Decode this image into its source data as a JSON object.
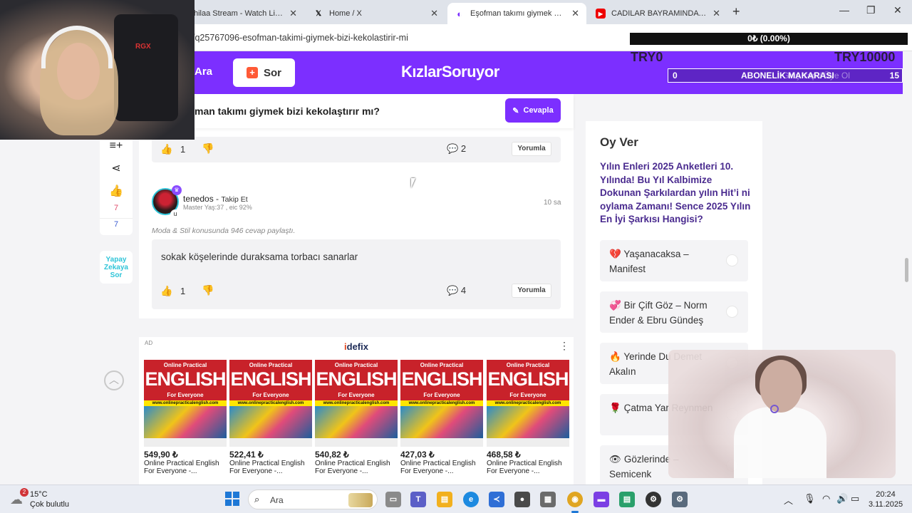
{
  "browser": {
    "tabs": [
      {
        "title": "hilaa Stream - Watch Live on",
        "icon": "twitch-icon"
      },
      {
        "title": "Home / X",
        "icon": "x-logo-icon"
      },
      {
        "title": "Eşofman takımı giymek bizi kek",
        "icon": "kizlarsoruyor-icon",
        "active": true
      },
      {
        "title": "CADILAR BAYRAMINDA EVLEN",
        "icon": "youtube-icon"
      }
    ],
    "url": "/q25767096-esofman-takimi-giymek-bizi-kekolastirir-mi"
  },
  "overlay": {
    "progress_text": "0₺ (0.00%)",
    "progress_fraction": 0.0,
    "try_left": "TRY0",
    "try_right": "TRY10000",
    "sub_left": "0",
    "sub_label": "ABONELİK MAKARASI",
    "sub_right": "15",
    "ghost_text": "Giriş Yap / Üye Ol"
  },
  "header": {
    "search_label": "Ara",
    "ask_button": "Sor",
    "logo": "KızlarSoruyor"
  },
  "question": {
    "title": "man takımı giymek bizi kekolaştırır mı?",
    "answer_button": "Cevapla"
  },
  "sidebar": {
    "likes_count": "7",
    "dislikes_count": "7",
    "ai_button": "Yapay Zekaya Sor"
  },
  "answers": [
    {
      "likes": "1",
      "comments": "2",
      "comment_button": "Yorumla"
    },
    {
      "username": "tenedos",
      "follow": "Takip Et",
      "meta": "Master Yaş:37 , eic 92%",
      "time": "10 sa",
      "context": "Moda & Stil konusunda 946 cevap paylaştı.",
      "text": "sokak köşelerinde duraksama torbacı sanarlar",
      "likes": "1",
      "comments": "4",
      "comment_button": "Yorumla"
    }
  ],
  "ad": {
    "tag": "AD",
    "brand_prefix": "i",
    "brand_rest": "defix",
    "book_line1": "Online Practical",
    "book_line2": "ENGLISH",
    "book_line3": "For Everyone",
    "book_band": "www.onlinepracticalenglish.com",
    "products": [
      {
        "price": "549,90 ₺",
        "name": "Online Practical English For Everyone -..."
      },
      {
        "price": "522,41 ₺",
        "name": "Online Practical English For Everyone -..."
      },
      {
        "price": "540,82 ₺",
        "name": "Online Practical English For Everyone -..."
      },
      {
        "price": "427,03 ₺",
        "name": "Online Practical English For Everyone -..."
      },
      {
        "price": "468,58 ₺",
        "name": "Online Practical English For Everyone -..."
      }
    ]
  },
  "poll": {
    "heading": "Oy Ver",
    "question": "Yılın Enleri 2025 Anketleri 10. Yılında! Bu Yıl Kalbimize Dokunan Şarkılardan yılın Hit’i ni oylama Zamanı! Sence 2025 Yılın En İyi Şarkısı Hangisi?",
    "options": [
      {
        "emoji": "💔",
        "label": "Yaşanacaksa – Manifest"
      },
      {
        "emoji": "💞",
        "label": "Bir Çift Göz – Norm Ender & Ebru Gündeş"
      },
      {
        "emoji": "🔥",
        "label": "Yerinde Du Demet Akalın"
      },
      {
        "emoji": "🌹",
        "label": "Çatma Yar Reynmen"
      },
      {
        "emoji": "👁",
        "label": "Gözlerinde – Semicenk"
      }
    ]
  },
  "taskbar": {
    "temperature": "15°C",
    "weather": "Çok bulutlu",
    "weather_badge": "2",
    "search_label": "Ara",
    "time": "20:24",
    "date": "3.11.2025"
  },
  "stream": {
    "cam_tag": "RGX"
  }
}
